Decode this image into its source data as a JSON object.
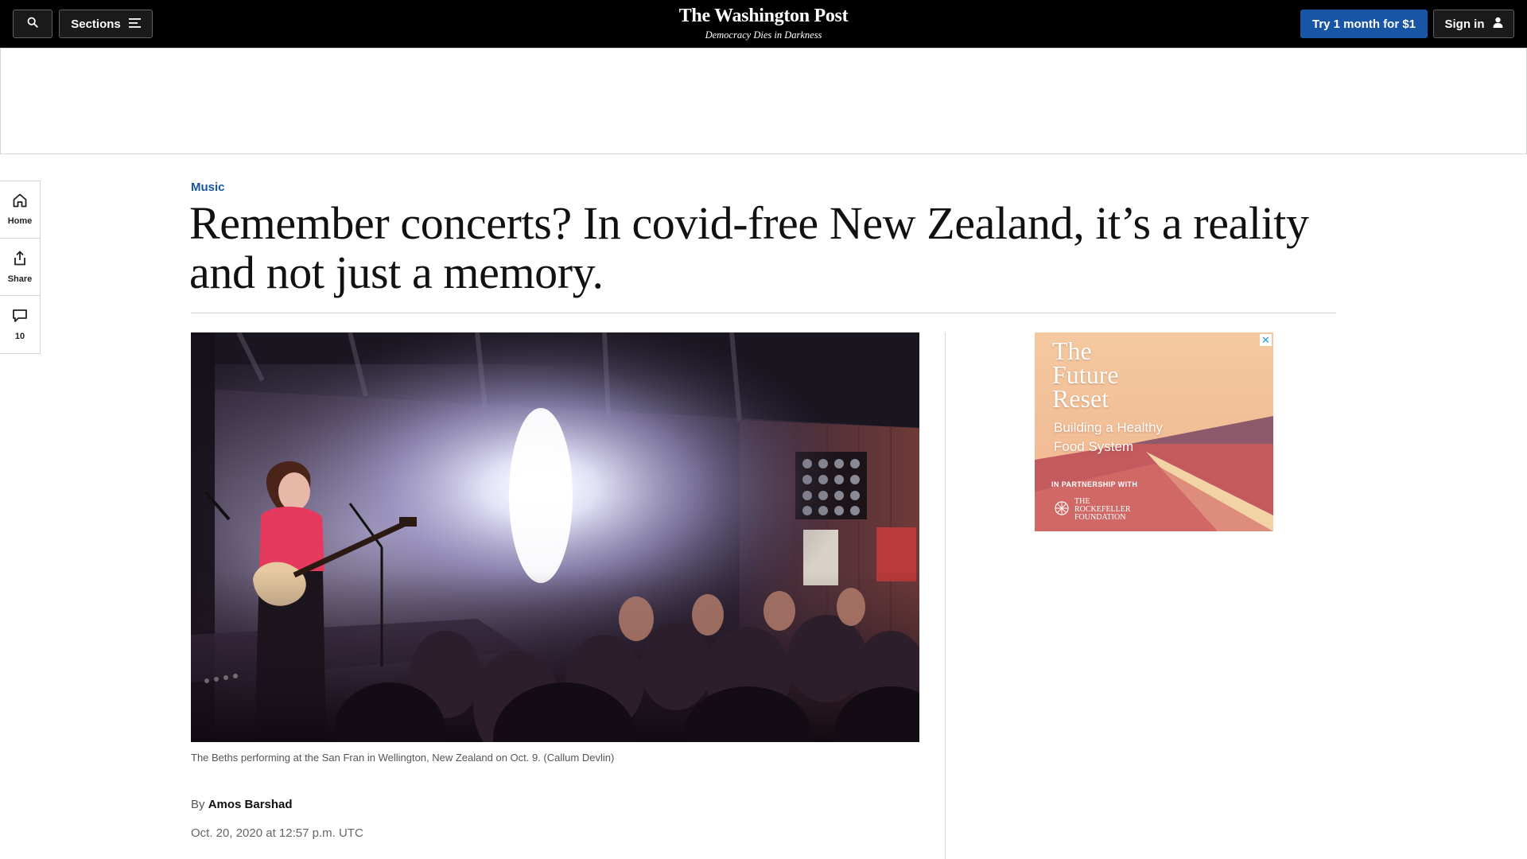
{
  "topbar": {
    "sections_label": "Sections",
    "logo": "The Washington Post",
    "tagline": "Democracy Dies in Darkness",
    "try_label": "Try 1 month for $1",
    "signin_label": "Sign in"
  },
  "rail": {
    "home_label": "Home",
    "share_label": "Share",
    "comments_count": "10"
  },
  "article": {
    "kicker": "Music",
    "headline": "Remember concerts? In covid-free New Zealand, it’s a reality and not just a memory.",
    "caption": "The Beths performing at the San Fran in Wellington, New Zealand on Oct. 9. (Callum Devlin)",
    "byline_prefix": "By",
    "author": "Amos Barshad",
    "timestamp": "Oct. 20, 2020 at 12:57 p.m. UTC"
  },
  "side_ad": {
    "title": "The\nFuture\nReset",
    "subtitle": "Building a Healthy\nFood System",
    "partner_label": "IN PARTNERSHIP WITH",
    "foundation": "THE\nROCKEFELLER\nFOUNDATION",
    "close": "✕"
  },
  "colors": {
    "topbar_bg": "#000000",
    "subscribe_button": "#1955a5",
    "kicker": "#1955a5",
    "divider": "#d5d5d5"
  },
  "icons": {
    "search": "search-icon",
    "sections": "hamburger-icon",
    "signin": "user-icon",
    "home": "home-icon",
    "share": "share-icon",
    "comments": "comment-icon"
  }
}
